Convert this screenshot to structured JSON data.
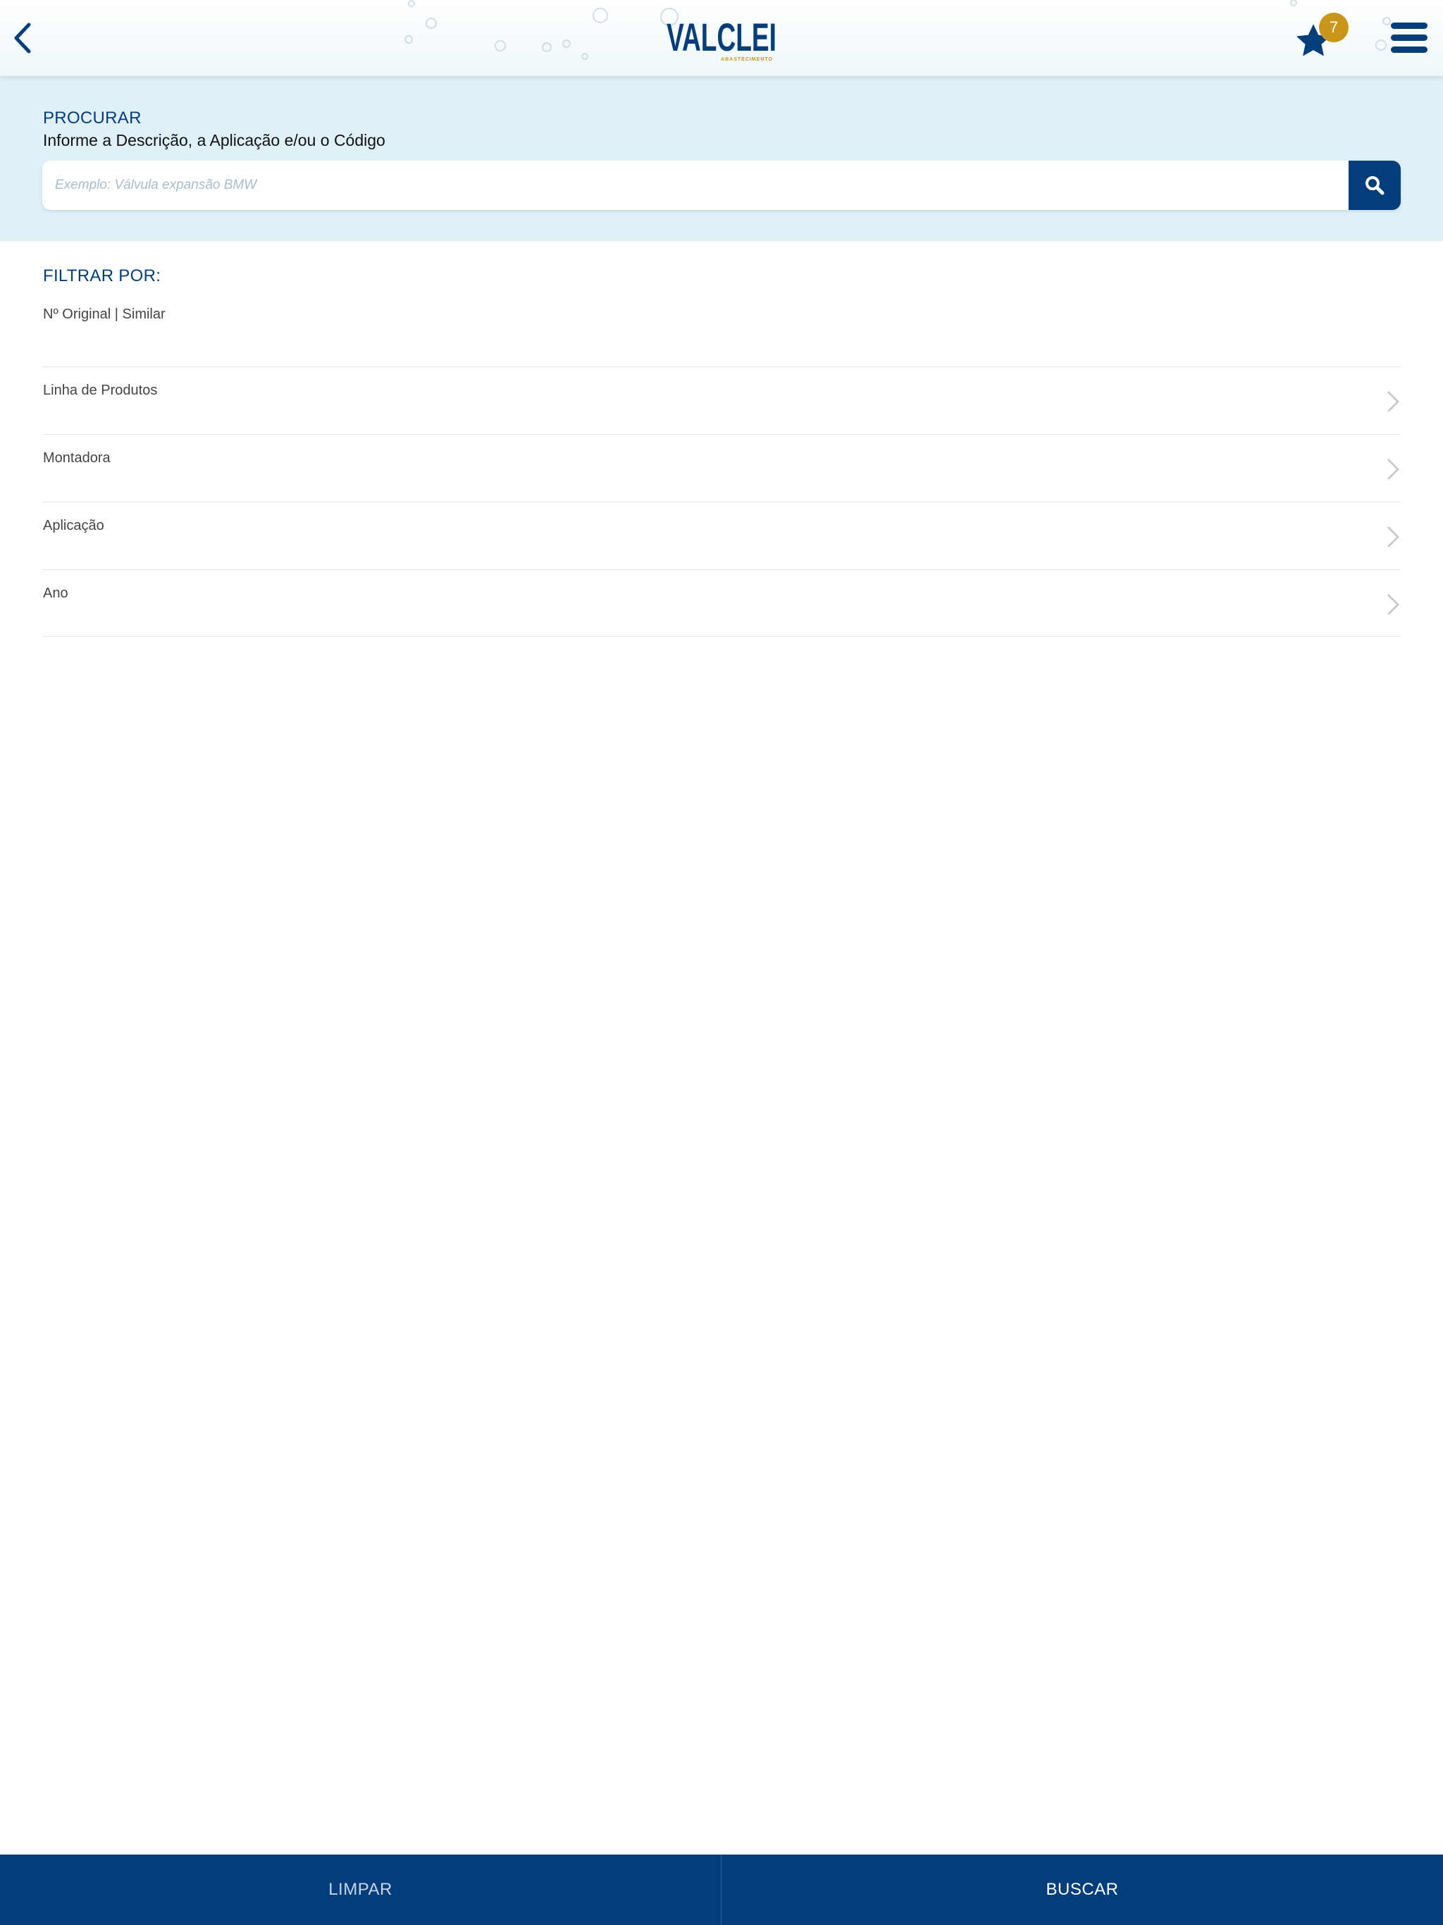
{
  "header": {
    "logo_text": "VALCLEI",
    "logo_tagline": "ABASTECIMENTO",
    "favorites_count": "7",
    "icons": [
      "back-chevron-icon",
      "star-icon",
      "hamburger-menu-icon"
    ]
  },
  "search": {
    "title": "PROCURAR",
    "subtitle": "Informe a Descrição, a Aplicação e/ou o Código",
    "placeholder": "Exemplo: Válvula expansão BMW",
    "button_icon": "search-icon"
  },
  "filters": {
    "title": "FILTRAR POR:",
    "original_label": "Nº Original | Similar",
    "items": [
      {
        "label": "Linha de Produtos"
      },
      {
        "label": "Montadora"
      },
      {
        "label": "Aplicação"
      },
      {
        "label": "Ano"
      }
    ]
  },
  "bottom": {
    "clear_label": "LIMPAR",
    "search_label": "BUSCAR"
  },
  "colors": {
    "brand_blue": "#033d7a",
    "badge_gold": "#c9961a",
    "search_band": "#dff0f8"
  }
}
